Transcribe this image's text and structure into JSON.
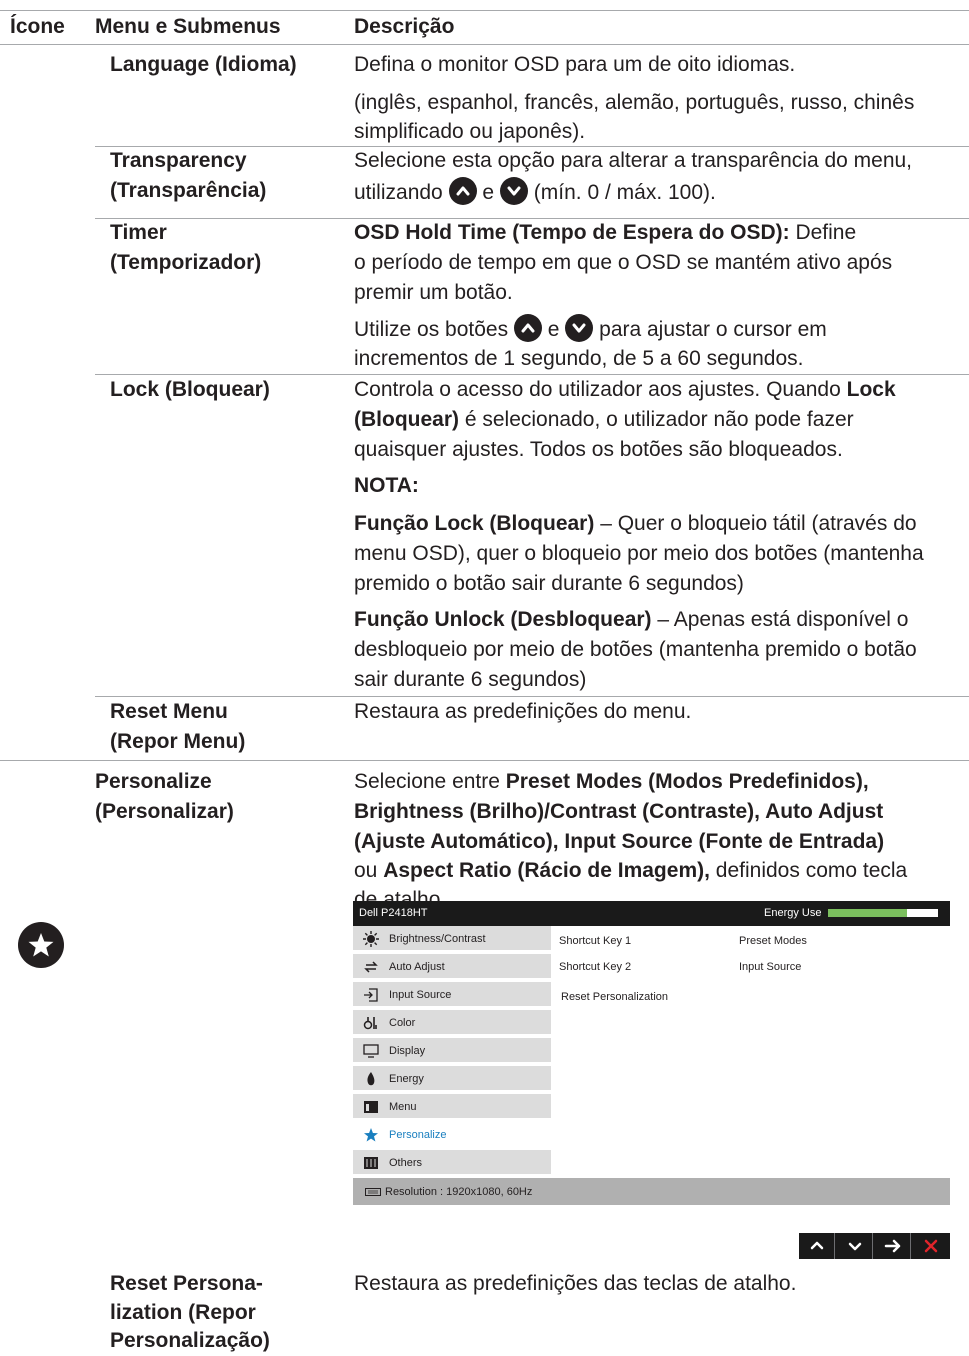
{
  "header": {
    "col_icon": "Ícone",
    "col_menu": "Menu e Submenus",
    "col_desc": "Descrição"
  },
  "rows": {
    "language": {
      "menu": "Language (Idioma)",
      "desc1": "Defina o monitor OSD para um de oito idiomas.",
      "desc2a": "(inglês, espanhol, francês, alemão, português, russo, chinês",
      "desc2b": "simplificado ou japonês)."
    },
    "transparency": {
      "menu1": "Transparency",
      "menu2": "(Transparência)",
      "desc1": "Selecione esta opção para alterar a transparência do menu,",
      "desc2_pre": "utilizando",
      "desc2_mid": "e",
      "desc2_post": "(mín. 0 / máx. 100)."
    },
    "timer": {
      "menu1": "Timer",
      "menu2": "(Temporizador)",
      "desc1_bold": "OSD Hold Time (Tempo de Espera do OSD):",
      "desc1_rest": "Define",
      "desc2": "o período de tempo em que o OSD se mantém ativo após",
      "desc3": "premir um botão.",
      "desc4_pre": "Utilize os botões",
      "desc4_mid": "e",
      "desc4_post": "para ajustar o cursor em",
      "desc5": "incrementos de 1 segundo, de 5 a 60 segundos."
    },
    "lock": {
      "menu": "Lock (Bloquear)",
      "p1a": "Controla o acesso do utilizador aos ajustes. Quando",
      "p1a_bold": "Lock",
      "p1b_bold": "(Bloquear)",
      "p1b": "é selecionado, o utilizador não pode fazer",
      "p1c": "quaisquer ajustes. Todos os botões são bloqueados.",
      "note": "NOTA:",
      "f1_bold": "Função Lock (Bloquear)",
      "f1a": "– Quer o bloqueio tátil (através do",
      "f1b": "menu OSD), quer o bloqueio por meio dos botões (mantenha",
      "f1c": "premido o botão sair durante 6 segundos)",
      "f2_bold": "Função Unlock (Desbloquear)",
      "f2a": "– Apenas está disponível o",
      "f2b": "desbloqueio por meio de botões (mantenha premido o botão",
      "f2c": "sair durante 6 segundos)"
    },
    "reset_menu": {
      "menu1": "Reset Menu",
      "menu2": "(Repor Menu)",
      "desc": "Restaura as predefinições do menu."
    },
    "personalize": {
      "icon": "star-icon",
      "menu1": "Personalize",
      "menu2": "(Personalizar)",
      "d1_pre": "Selecione entre",
      "d1_bold": "Preset Modes (Modos Predefinidos),",
      "d2_bold": "Brightness (Brilho)/Contrast (Contraste), Auto Adjust",
      "d3_bold": "(Ajuste Automático), Input Source (Fonte de Entrada)",
      "d4_pre": "ou",
      "d4_bold": "Aspect Ratio (Rácio de Imagem),",
      "d4_post": "definidos como tecla",
      "d5": "de atalho."
    },
    "reset_personalization": {
      "menu1": "Reset Persona-",
      "menu2": "lization (Repor",
      "menu3": "Personalização)",
      "desc": "Restaura as predefinições das teclas de atalho."
    }
  },
  "osd": {
    "title": "Dell P2418HT",
    "energy_label": "Energy Use",
    "energy_level": 0.72,
    "menu_items": [
      {
        "label": "Brightness/Contrast",
        "icon": "brightness-icon"
      },
      {
        "label": "Auto Adjust",
        "icon": "auto-adjust-icon"
      },
      {
        "label": "Input Source",
        "icon": "input-source-icon"
      },
      {
        "label": "Color",
        "icon": "color-icon"
      },
      {
        "label": "Display",
        "icon": "display-icon"
      },
      {
        "label": "Energy",
        "icon": "energy-icon"
      },
      {
        "label": "Menu",
        "icon": "menu-icon"
      },
      {
        "label": "Personalize",
        "icon": "star-icon"
      },
      {
        "label": "Others",
        "icon": "others-icon"
      }
    ],
    "shortcut1_label": "Shortcut Key 1",
    "shortcut1_value": "Preset Modes",
    "shortcut2_label": "Shortcut Key 2",
    "shortcut2_value": "Input Source",
    "reset_label": "Reset Personalization",
    "status": "Resolution : 1920x1080, 60Hz",
    "selected_color": "#1a7fbf"
  },
  "nav_buttons": [
    "up-icon",
    "down-icon",
    "right-arrow-icon",
    "close-icon"
  ]
}
